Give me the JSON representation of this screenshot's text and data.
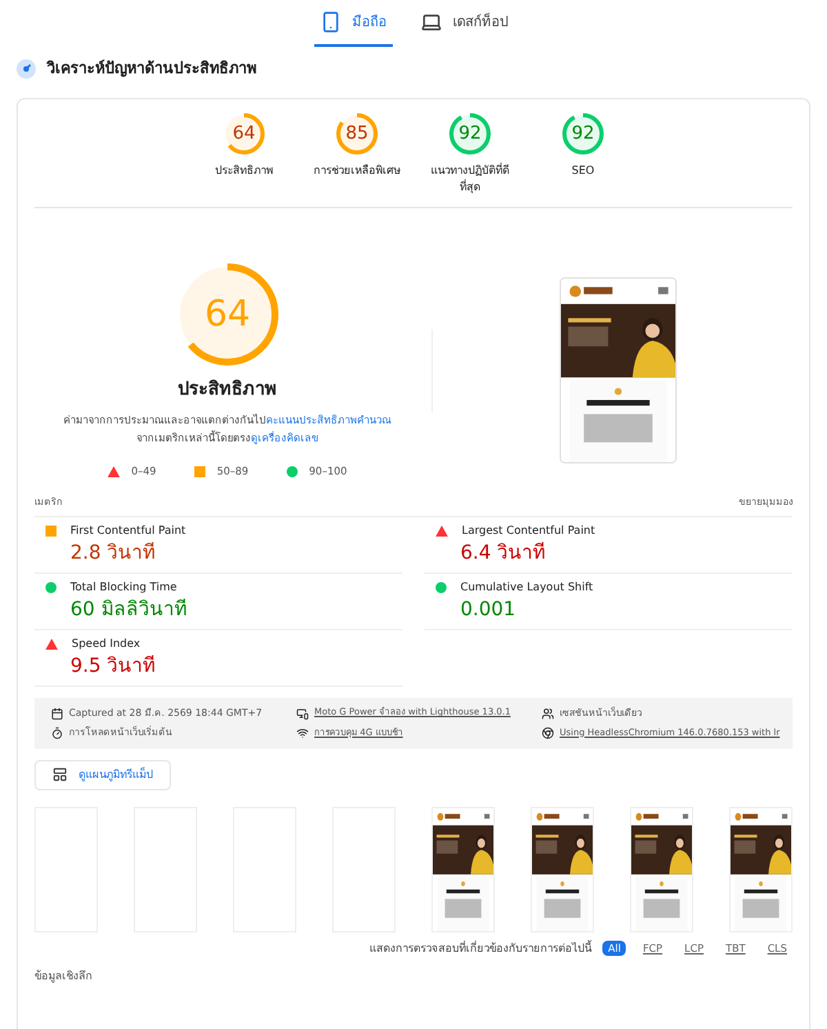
{
  "tabs": [
    {
      "label": "มือถือ",
      "selected": true
    },
    {
      "label": "เดสก์ท็อป",
      "selected": false
    }
  ],
  "section_title": "วิเคราะห์ปัญหาด้านประสิทธิภาพ",
  "category_scores": [
    {
      "score": "64",
      "label": "ประสิทธิภาพ",
      "kind": "average",
      "level": 0.64
    },
    {
      "score": "85",
      "label": "การช่วยเหลือพิเศษ",
      "kind": "average",
      "level": 0.85
    },
    {
      "score": "92",
      "label": "แนวทางปฏิบัติที่ดีที่สุด",
      "kind": "pass",
      "level": 0.92
    },
    {
      "score": "92",
      "label": "SEO",
      "kind": "pass",
      "level": 0.92
    }
  ],
  "main_score": {
    "score": "64",
    "kind": "average",
    "level": 0.64,
    "title": "ประสิทธิภาพ"
  },
  "description": {
    "before": "ค่ามาจากการประมาณและอาจแตกต่างกันไป",
    "link1": "คะแนนประสิทธิภาพคำนวณ",
    "middle": "จากเมตริกเหล่านี้โดยตรง",
    "link2": "ดูเครื่องคิดเลข"
  },
  "legend": [
    {
      "kind": "fail",
      "range": "0–49"
    },
    {
      "kind": "average",
      "range": "50–89"
    },
    {
      "kind": "pass",
      "range": "90–100"
    }
  ],
  "metrics_header": {
    "title": "เมตริก",
    "toggle": "ขยายมุมมอง"
  },
  "metrics": [
    {
      "name": "First Contentful Paint",
      "value": "2.8 วินาที",
      "kind": "average"
    },
    {
      "name": "Largest Contentful Paint",
      "value": "6.4 วินาที",
      "kind": "fail"
    },
    {
      "name": "Total Blocking Time",
      "value": "60 มิลลิวินาที",
      "kind": "pass"
    },
    {
      "name": "Cumulative Layout Shift",
      "value": "0.001",
      "kind": "pass"
    },
    {
      "name": "Speed Index",
      "value": "9.5 วินาที",
      "kind": "fail"
    }
  ],
  "run_info": [
    {
      "text": "Captured at 28 มี.ค. 2569 18:44 GMT+7",
      "kind": "text"
    },
    {
      "text": "Moto G Power จำลอง with Lighthouse 13.0.1",
      "kind": "link"
    },
    {
      "text": "เซสชันหน้าเว็บเดียว",
      "kind": "text"
    },
    {
      "text": "การโหลดหน้าเว็บเริ่มต้น",
      "kind": "text"
    },
    {
      "text": "การควบคุม 4G แบบช้า",
      "kind": "link"
    },
    {
      "text": "Using HeadlessChromium 146.0.7680.153 with lr",
      "kind": "link"
    }
  ],
  "treemap_button": "ดูแผนภูมิทรีแม็ป",
  "filmstrip": [
    {
      "kind": "blank"
    },
    {
      "kind": "blank"
    },
    {
      "kind": "blank"
    },
    {
      "kind": "blank"
    },
    {
      "kind": "picture"
    },
    {
      "kind": "picture"
    },
    {
      "kind": "picture"
    },
    {
      "kind": "picture"
    }
  ],
  "filter": {
    "label": "แสดงการตรวจสอบที่เกี่ยวข้องกับรายการต่อไปนี้",
    "chips": [
      {
        "label": "All",
        "selected": true
      },
      {
        "label": "FCP",
        "selected": false
      },
      {
        "label": "LCP",
        "selected": false
      },
      {
        "label": "TBT",
        "selected": false
      },
      {
        "label": "CLS",
        "selected": false
      }
    ]
  },
  "insights_title": "ข้อมูลเชิงลึก"
}
